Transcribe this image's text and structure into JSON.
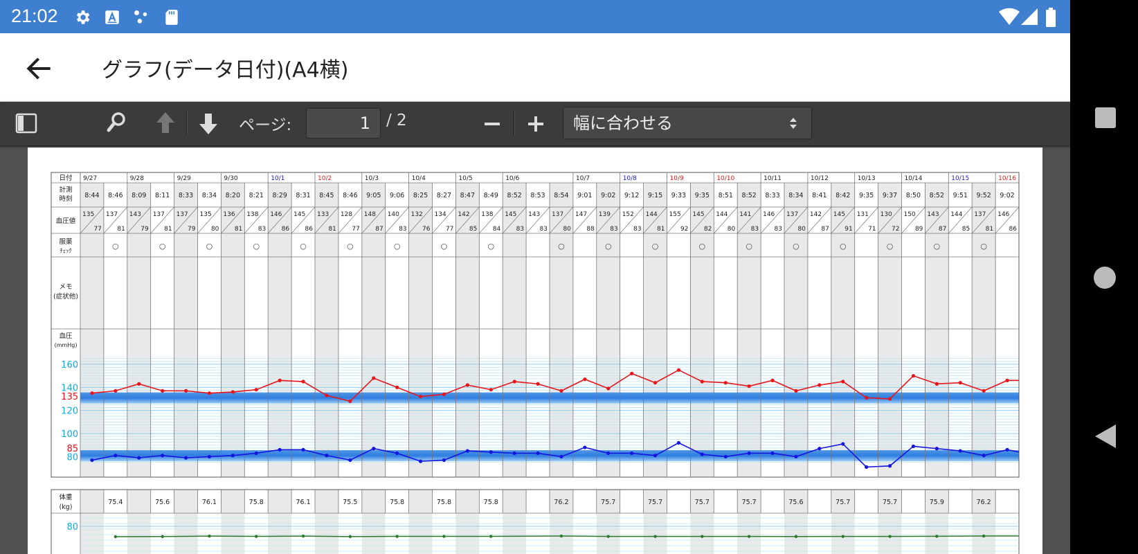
{
  "status_bar": {
    "time": "21:02"
  },
  "app_bar": {
    "title": "グラフ(データ日付)(A4横)"
  },
  "toolbar": {
    "page_label": "ページ:",
    "page_value": "1",
    "page_total": "/ 2",
    "zoom_value": "幅に合わせる"
  },
  "chart_data": {
    "type": "line",
    "row_labels": {
      "date": "日付",
      "time_1": "計測",
      "time_2": "時刻",
      "bp": "血圧値",
      "med_1": "服薬",
      "med_2": "ﾁｪｯｸ",
      "memo_1": "メモ",
      "memo_2": "(症状他)",
      "graph_1": "血圧",
      "graph_2": "(mmHg)",
      "weight_1": "体重",
      "weight_2": "(kg)"
    },
    "dates": [
      {
        "label": "9/27",
        "span": 2,
        "color": "black"
      },
      {
        "label": "9/28",
        "span": 2,
        "color": "black"
      },
      {
        "label": "9/29",
        "span": 2,
        "color": "black"
      },
      {
        "label": "9/30",
        "span": 2,
        "color": "black"
      },
      {
        "label": "10/1",
        "span": 2,
        "color": "blue"
      },
      {
        "label": "10/2",
        "span": 2,
        "color": "red"
      },
      {
        "label": "10/3",
        "span": 2,
        "color": "black"
      },
      {
        "label": "10/4",
        "span": 2,
        "color": "black"
      },
      {
        "label": "10/5",
        "span": 2,
        "color": "black"
      },
      {
        "label": "10/6",
        "span": 3,
        "color": "black"
      },
      {
        "label": "10/7",
        "span": 2,
        "color": "black"
      },
      {
        "label": "10/8",
        "span": 2,
        "color": "blue"
      },
      {
        "label": "10/9",
        "span": 2,
        "color": "red"
      },
      {
        "label": "10/10",
        "span": 2,
        "color": "red"
      },
      {
        "label": "10/11",
        "span": 2,
        "color": "black"
      },
      {
        "label": "10/12",
        "span": 2,
        "color": "black"
      },
      {
        "label": "10/13",
        "span": 2,
        "color": "black"
      },
      {
        "label": "10/14",
        "span": 2,
        "color": "black"
      },
      {
        "label": "10/15",
        "span": 2,
        "color": "blue"
      },
      {
        "label": "10/16",
        "span": 1,
        "color": "red"
      }
    ],
    "times": [
      "8:44",
      "8:46",
      "8:09",
      "8:11",
      "8:33",
      "8:34",
      "8:20",
      "8:21",
      "8:29",
      "8:31",
      "8:45",
      "8:46",
      "9:05",
      "9:06",
      "8:25",
      "8:27",
      "8:47",
      "8:49",
      "8:52",
      "8:53",
      "8:54",
      "9:01",
      "9:02",
      "9:12",
      "9:15",
      "9:33",
      "9:35",
      "8:51",
      "8:52",
      "8:33",
      "8:34",
      "8:41",
      "8:42",
      "9:35",
      "9:37",
      "8:50",
      "8:52",
      "9:51",
      "9:52",
      "9:02"
    ],
    "systolic": [
      135,
      137,
      143,
      137,
      137,
      135,
      136,
      138,
      146,
      145,
      133,
      128,
      148,
      140,
      132,
      134,
      142,
      138,
      145,
      143,
      137,
      147,
      139,
      152,
      144,
      155,
      145,
      144,
      141,
      146,
      137,
      142,
      145,
      131,
      130,
      150,
      143,
      144,
      137,
      146
    ],
    "diastolic": [
      77,
      81,
      79,
      81,
      79,
      80,
      81,
      83,
      86,
      86,
      81,
      77,
      87,
      83,
      76,
      77,
      85,
      84,
      83,
      83,
      80,
      88,
      83,
      83,
      81,
      92,
      82,
      80,
      83,
      83,
      80,
      87,
      91,
      71,
      72,
      89,
      87,
      85,
      81,
      86
    ],
    "medication": [
      "",
      "○",
      "",
      "○",
      "",
      "○",
      "",
      "○",
      "",
      "○",
      "",
      "○",
      "",
      "○",
      "",
      "○",
      "",
      "○",
      "",
      "",
      "○",
      "",
      "○",
      "",
      "○",
      "",
      "○",
      "",
      "○",
      "",
      "○",
      "",
      "○",
      "",
      "○",
      "",
      "○",
      "",
      "○",
      ""
    ],
    "weight": [
      "",
      "75.4",
      "",
      "75.6",
      "",
      "76.1",
      "",
      "75.8",
      "",
      "76.1",
      "",
      "75.5",
      "",
      "75.8",
      "",
      "75.8",
      "",
      "75.8",
      "",
      "",
      "76.2",
      "",
      "75.7",
      "",
      "75.7",
      "",
      "75.7",
      "",
      "75.7",
      "",
      "75.6",
      "",
      "75.7",
      "",
      "75.7",
      "",
      "75.9",
      "",
      "76.2",
      ""
    ],
    "y_ticks": [
      "160",
      "140",
      "120",
      "100",
      "80"
    ],
    "target_systolic_label": "135",
    "target_diastolic_label": "85",
    "weight_tick": "80",
    "ylim": [
      70,
      170
    ],
    "colors": {
      "systolic": "#e8141a",
      "diastolic": "#1414e0",
      "weight": "#2a7a2a",
      "tick": "#18a8e0",
      "target": "#e8141a",
      "band": "#5aa6ee"
    }
  }
}
